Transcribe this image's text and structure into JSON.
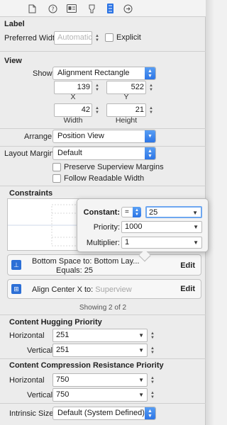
{
  "toolbar": {
    "icons": [
      "file-icon",
      "help-icon",
      "identity-icon",
      "attributes-icon",
      "size-icon",
      "connections-icon"
    ]
  },
  "label_section": {
    "title": "Label",
    "preferred_width_label": "Preferred Width",
    "preferred_width_placeholder": "Automatic",
    "explicit_label": "Explicit"
  },
  "view_section": {
    "title": "View",
    "show_label": "Show",
    "show_value": "Alignment Rectangle",
    "x_value": "139",
    "x_label": "X",
    "y_value": "522",
    "y_label": "Y",
    "width_value": "42",
    "width_label": "Width",
    "height_value": "21",
    "height_label": "Height",
    "arrange_label": "Arrange",
    "arrange_value": "Position View",
    "layout_margins_label": "Layout Margins",
    "layout_margins_value": "Default",
    "preserve_superview_label": "Preserve Superview Margins",
    "follow_readable_label": "Follow Readable Width"
  },
  "constraints": {
    "title": "Constraints",
    "rows": [
      {
        "line1_prefix": "Bottom Space to:",
        "line1_value": "Bottom Lay...",
        "line2": "Equals:  25",
        "edit_label": "Edit"
      },
      {
        "line1_prefix": "Align Center X to:",
        "line1_value": "Superview",
        "edit_label": "Edit"
      }
    ],
    "showing": "Showing 2 of 2"
  },
  "popover": {
    "constant_label": "Constant:",
    "relation_value": "=",
    "constant_value": "25",
    "priority_label": "Priority:",
    "priority_value": "1000",
    "multiplier_label": "Multiplier:",
    "multiplier_value": "1"
  },
  "hugging": {
    "title": "Content Hugging Priority",
    "horizontal_label": "Horizontal",
    "horizontal_value": "251",
    "vertical_label": "Vertical",
    "vertical_value": "251"
  },
  "compression": {
    "title": "Content Compression Resistance Priority",
    "horizontal_label": "Horizontal",
    "horizontal_value": "750",
    "vertical_label": "Vertical",
    "vertical_value": "750"
  },
  "intrinsic": {
    "label": "Intrinsic Size",
    "value": "Default (System Defined)"
  },
  "colors": {
    "accent": "#2b73e4",
    "panel": "#ececec"
  }
}
